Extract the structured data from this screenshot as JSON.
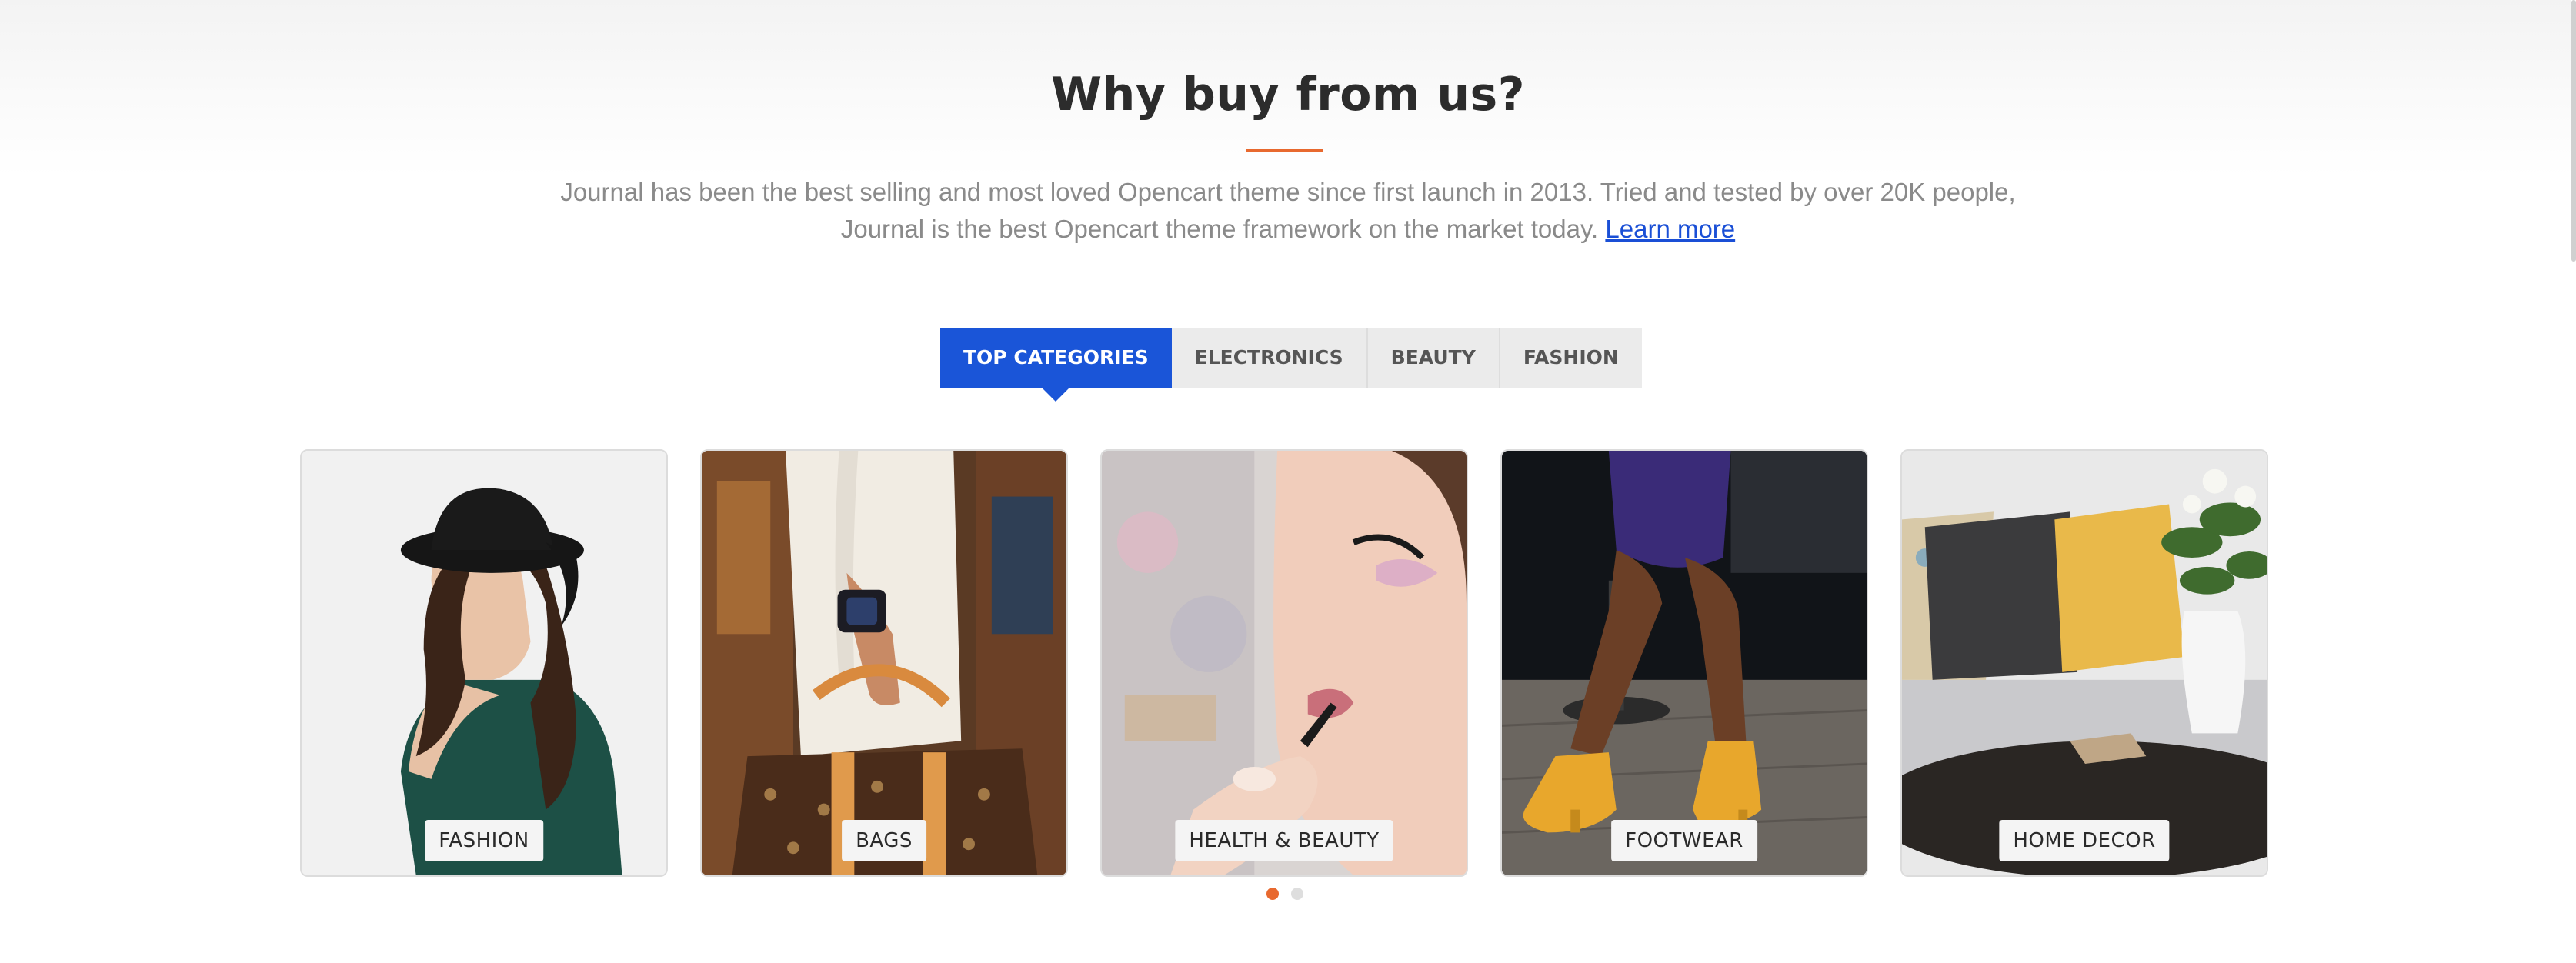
{
  "section": {
    "title": "Why buy from us?",
    "description": "Journal has been the best selling and most loved Opencart theme since first launch in 2013. Tried and tested by over 20K people, Journal is the best Opencart theme framework on the market today.",
    "link_label": "Learn more"
  },
  "tabs": [
    {
      "label": "TOP CATEGORIES",
      "active": true
    },
    {
      "label": "ELECTRONICS",
      "active": false
    },
    {
      "label": "BEAUTY",
      "active": false
    },
    {
      "label": "FASHION",
      "active": false
    }
  ],
  "categories": [
    {
      "label": "FASHION"
    },
    {
      "label": "BAGS"
    },
    {
      "label": "HEALTH & BEAUTY"
    },
    {
      "label": "FOOTWEAR"
    },
    {
      "label": "HOME DECOR"
    }
  ],
  "carousel": {
    "page_count": 2,
    "active_page": 1
  },
  "colors": {
    "accent": "#e8692f",
    "tab_active": "#1a55d8",
    "link": "#1a4fd6"
  }
}
